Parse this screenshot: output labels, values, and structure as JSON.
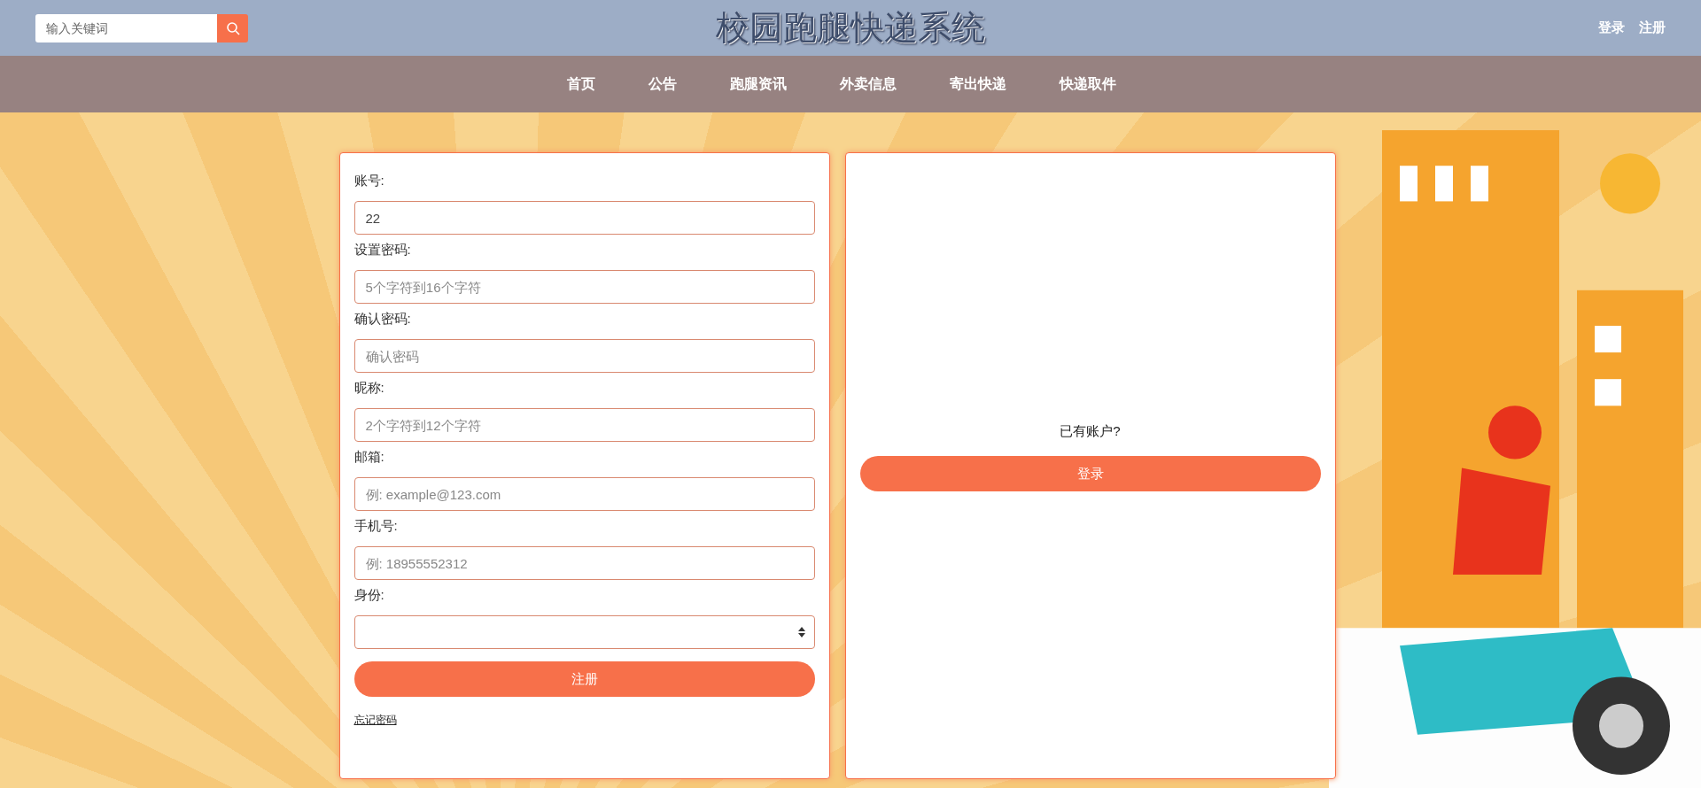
{
  "header": {
    "search": {
      "placeholder": "输入关键词"
    },
    "title": "校园跑腿快递系统",
    "links": [
      "登录",
      "注册"
    ]
  },
  "nav": [
    "首页",
    "公告",
    "跑腿资讯",
    "外卖信息",
    "寄出快递",
    "快递取件"
  ],
  "register_form": {
    "fields": [
      {
        "kind": "text",
        "label": "账号:",
        "value": "22"
      },
      {
        "kind": "text",
        "label": "设置密码:",
        "placeholder": "5个字符到16个字符"
      },
      {
        "kind": "text",
        "label": "确认密码:",
        "placeholder": "确认密码"
      },
      {
        "kind": "text",
        "label": "昵称:",
        "placeholder": "2个字符到12个字符"
      },
      {
        "kind": "text",
        "label": "邮箱:",
        "placeholder": "例: example@123.com"
      },
      {
        "kind": "text",
        "label": "手机号:",
        "placeholder": "例: 18955552312"
      },
      {
        "kind": "select",
        "label": "身份:"
      }
    ],
    "submit": "注册",
    "forgot_link": "忘记密码"
  },
  "login_panel": {
    "prompt": "已有账户?",
    "button": "登录"
  }
}
